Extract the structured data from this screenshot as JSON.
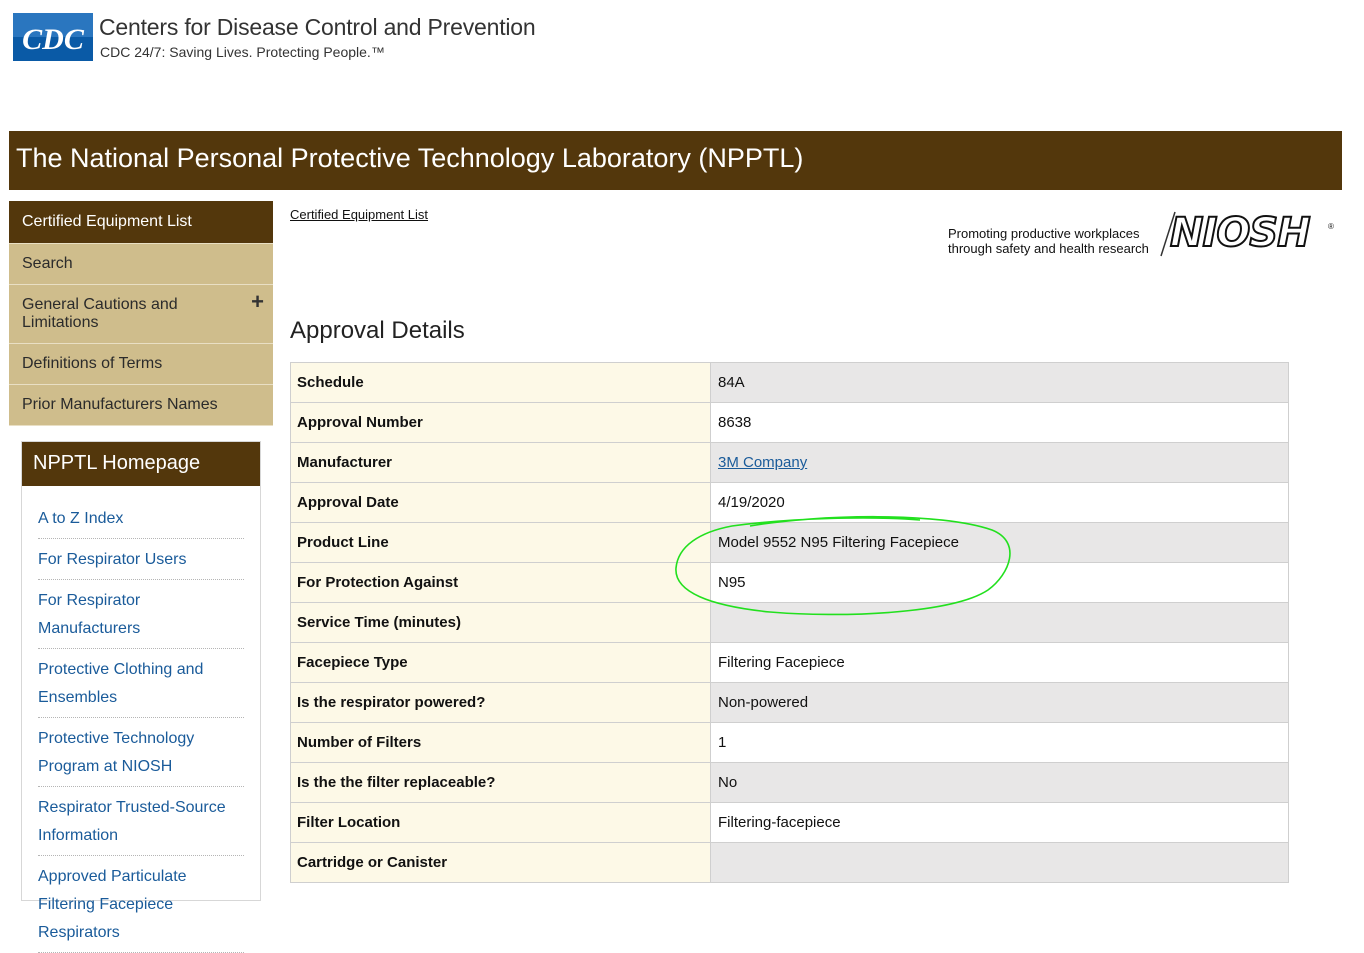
{
  "header": {
    "logo_text": "CDC",
    "site_name": "Centers for Disease Control and Prevention",
    "tagline": "CDC 24/7: Saving Lives. Protecting People.™"
  },
  "banner": {
    "title": "The National Personal Protective Technology Laboratory (NPPTL)"
  },
  "side_nav": {
    "items": [
      {
        "label": "Certified Equipment List",
        "active": true
      },
      {
        "label": "Search"
      },
      {
        "label": "General Cautions and Limitations",
        "expandable": true
      },
      {
        "label": "Definitions of Terms"
      },
      {
        "label": "Prior Manufacturers Names"
      }
    ],
    "plus_glyph": "+"
  },
  "homepage_box": {
    "title": "NPPTL Homepage",
    "links": [
      "A to Z Index",
      "For Respirator Users",
      "For Respirator Manufacturers",
      "Protective Clothing and Ensembles",
      "Protective Technology Program at NIOSH",
      "Respirator Trusted-Source Information",
      "Approved Particulate Filtering Facepiece Respirators"
    ]
  },
  "breadcrumb": "Certified Equipment List",
  "niosh": {
    "tagline_line1": "Promoting productive workplaces",
    "tagline_line2": "through safety and health research",
    "logo_text": "NIOSH",
    "reg_mark": "®"
  },
  "page_heading": "Approval Details",
  "details": {
    "rows": [
      {
        "label": "Schedule",
        "value": "84A"
      },
      {
        "label": "Approval Number",
        "value": "8638"
      },
      {
        "label": "Manufacturer",
        "value": "3M Company",
        "link": true
      },
      {
        "label": "Approval Date",
        "value": "4/19/2020"
      },
      {
        "label": "Product Line",
        "value": "Model 9552 N95 Filtering Facepiece"
      },
      {
        "label": "For Protection Against",
        "value": "N95"
      },
      {
        "label": "Service Time (minutes)",
        "value": ""
      },
      {
        "label": "Facepiece Type",
        "value": "Filtering Facepiece"
      },
      {
        "label": "Is the respirator powered?",
        "value": "Non-powered"
      },
      {
        "label": "Number of Filters",
        "value": "1"
      },
      {
        "label": "Is the the filter replaceable?",
        "value": "No"
      },
      {
        "label": "Filter Location",
        "value": "Filtering-facepiece"
      },
      {
        "label": "Cartridge or Canister",
        "value": ""
      }
    ]
  },
  "colors": {
    "brand_brown": "#53370c",
    "nav_tan": "#cfbd8c",
    "link_blue": "#1a5b9a",
    "label_cream": "#fdf9e7",
    "row_gray": "#e8e7e7",
    "annotation_green": "#22e01e"
  }
}
